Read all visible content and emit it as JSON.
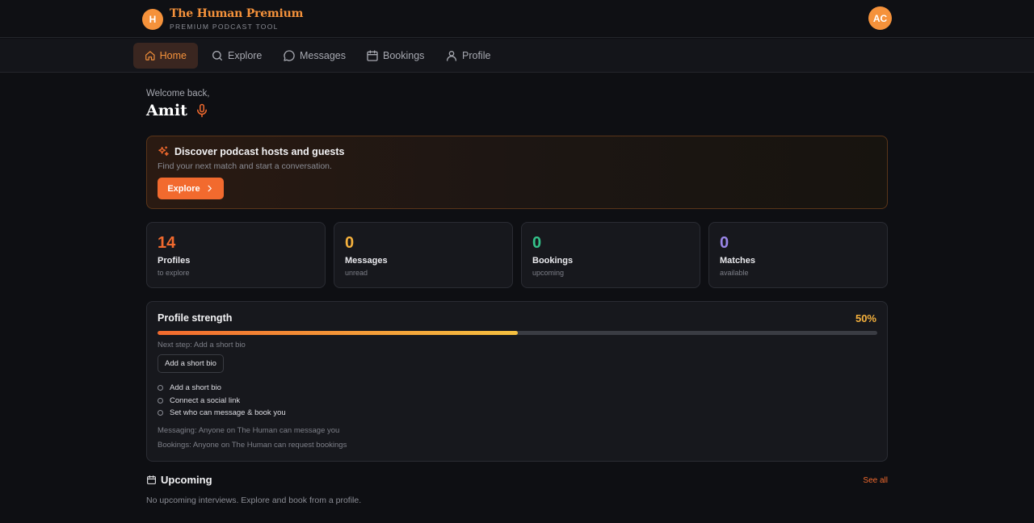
{
  "brand": {
    "logo_letter": "H",
    "name": "The Human Premium",
    "tagline": "PREMIUM PODCAST TOOL"
  },
  "user": {
    "initials": "AC"
  },
  "nav": {
    "items": [
      {
        "label": "Home",
        "icon": "home-icon",
        "active": true
      },
      {
        "label": "Explore",
        "icon": "search-icon"
      },
      {
        "label": "Messages",
        "icon": "message-icon"
      },
      {
        "label": "Bookings",
        "icon": "calendar-icon"
      },
      {
        "label": "Profile",
        "icon": "user-icon"
      }
    ]
  },
  "welcome": {
    "greeting": "Welcome back,",
    "name": "Amit",
    "icon": "microphone-icon"
  },
  "discover": {
    "icon": "sparkles-icon",
    "title": "Discover podcast hosts and guests",
    "subtitle": "Find your next match and start a conversation.",
    "button_label": "Explore"
  },
  "stats": [
    {
      "value": "14",
      "label": "Profiles",
      "sub": "to explore",
      "color": "#f26a2e"
    },
    {
      "value": "0",
      "label": "Messages",
      "sub": "unread",
      "color": "#f5b13d"
    },
    {
      "value": "0",
      "label": "Bookings",
      "sub": "upcoming",
      "color": "#34c28a"
    },
    {
      "value": "0",
      "label": "Matches",
      "sub": "available",
      "color": "#9a86e8"
    }
  ],
  "profile_strength": {
    "title": "Profile strength",
    "percent_label": "50%",
    "progress_fraction": 0.5,
    "next_step": "Next step: Add a short bio",
    "button_label": "Add a short bio",
    "checklist": [
      "Add a short bio",
      "Connect a social link",
      "Set who can message & book you"
    ],
    "messaging": "Messaging: Anyone on The Human can message you",
    "bookings": "Bookings: Anyone on The Human can request bookings"
  },
  "upcoming": {
    "icon": "calendar-icon",
    "title": "Upcoming",
    "see_all": "See all",
    "empty_text": "No upcoming interviews. Explore and book from a profile."
  },
  "colors": {
    "accent": "#f26a2e",
    "brand": "#f5923b",
    "background": "#0e0f13"
  }
}
